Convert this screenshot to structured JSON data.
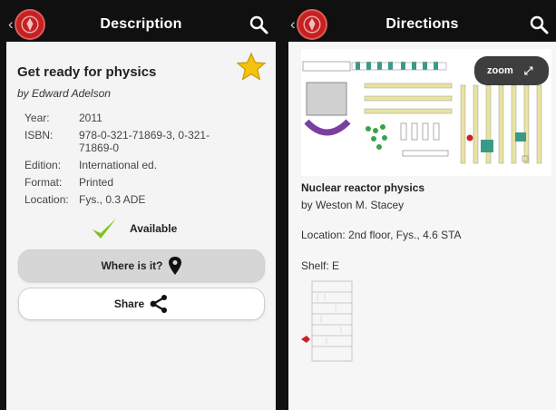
{
  "left": {
    "title": "Description",
    "book": {
      "title": "Get ready for physics",
      "author": "by Edward Adelson"
    },
    "meta": [
      {
        "key": "Year:",
        "value": "2011"
      },
      {
        "key": "ISBN:",
        "value": "978-0-321-71869-3, 0-321-71869-0"
      },
      {
        "key": "Edition:",
        "value": "International ed."
      },
      {
        "key": "Format:",
        "value": "Printed"
      },
      {
        "key": "Location:",
        "value": "Fys., 0.3 ADE"
      }
    ],
    "availability": "Available",
    "where_label": "Where is it?",
    "share_label": "Share"
  },
  "right": {
    "title": "Directions",
    "zoom_label": "zoom",
    "book_title": "Nuclear reactor physics",
    "book_author": "by Weston M. Stacey",
    "location": "Location: 2nd floor, Fys., 4.6 STA",
    "shelf": "Shelf: E"
  },
  "colors": {
    "accent": "#c42222",
    "star": "#f4c20d",
    "check": "#7cc21f",
    "bar": "#101010"
  }
}
